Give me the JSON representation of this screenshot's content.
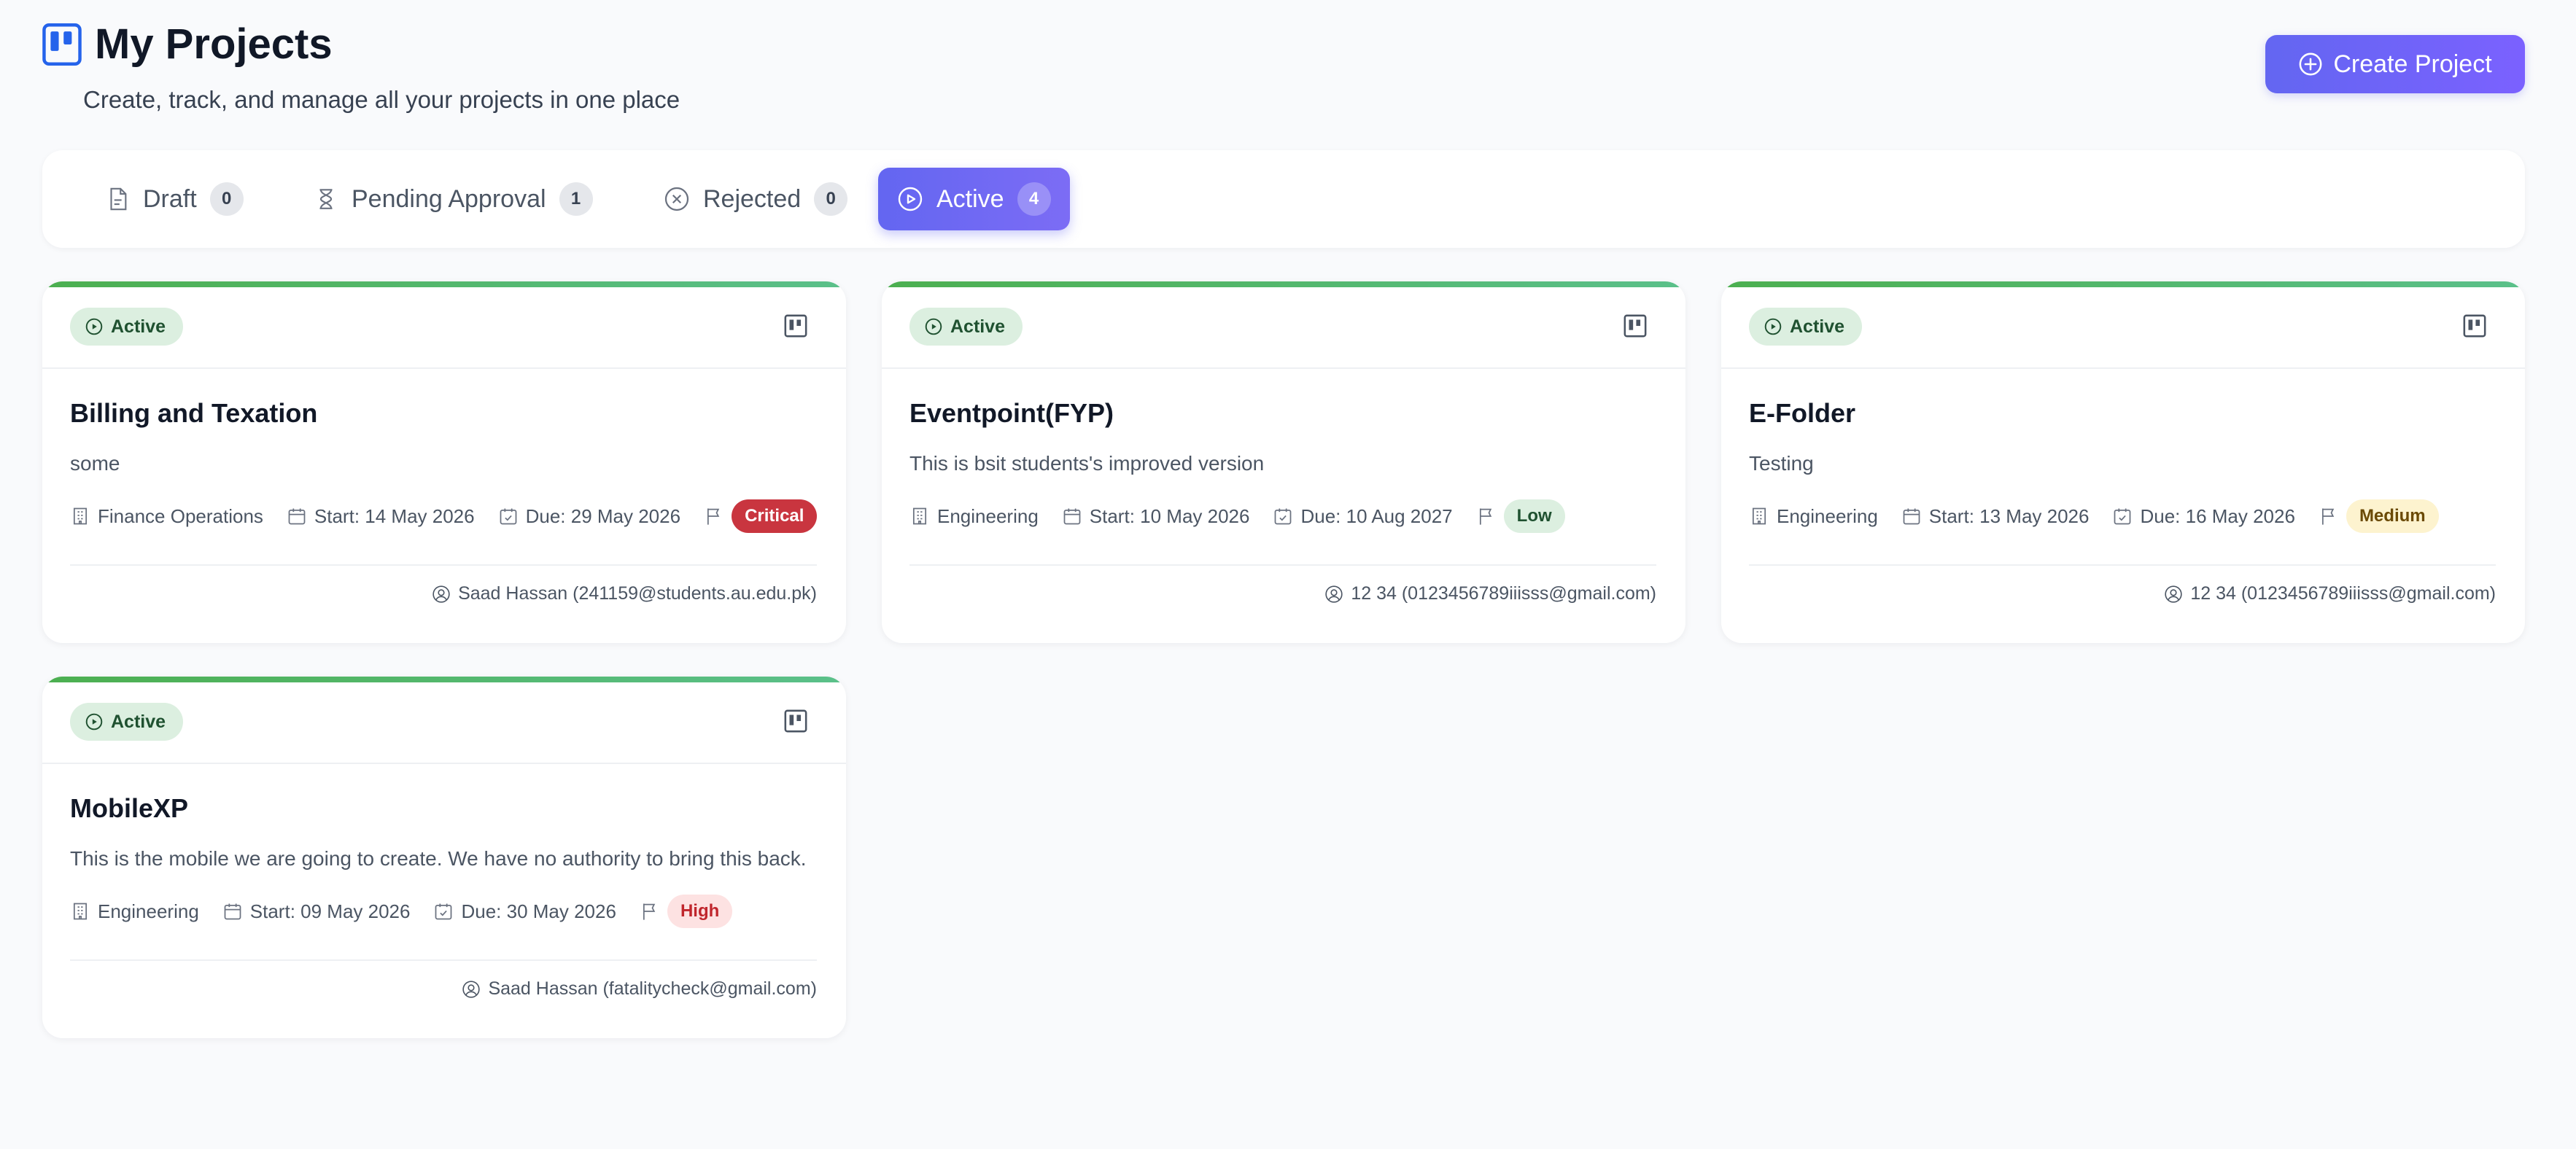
{
  "header": {
    "title": "My Projects",
    "subtitle": "Create, track, and manage all your projects in one place",
    "create_label": "Create Project"
  },
  "tabs": [
    {
      "label": "Draft",
      "count": "0",
      "icon": "document-icon"
    },
    {
      "label": "Pending Approval",
      "count": "1",
      "icon": "hourglass-icon"
    },
    {
      "label": "Rejected",
      "count": "0",
      "icon": "x-circle-icon"
    },
    {
      "label": "Active",
      "count": "4",
      "icon": "play-circle-icon",
      "selected": true
    }
  ],
  "cards": [
    {
      "status": "Active",
      "title": "Billing and Texation",
      "description": "some",
      "department": "Finance Operations",
      "start": "Start: 14 May 2026",
      "due": "Due: 29 May 2026",
      "priority": "Critical",
      "owner": "Saad Hassan (241159@students.au.edu.pk)"
    },
    {
      "status": "Active",
      "title": "Eventpoint(FYP)",
      "description": "This is bsit students's improved version",
      "department": "Engineering",
      "start": "Start: 10 May 2026",
      "due": "Due: 10 Aug 2027",
      "priority": "Low",
      "owner": "12 34 (0123456789iiisss@gmail.com)"
    },
    {
      "status": "Active",
      "title": "E-Folder",
      "description": "Testing",
      "department": "Engineering",
      "start": "Start: 13 May 2026",
      "due": "Due: 16 May 2026",
      "priority": "Medium",
      "owner": "12 34 (0123456789iiisss@gmail.com)"
    },
    {
      "status": "Active",
      "title": "MobileXP",
      "description": "This is the mobile we are going to create. We have no authority to bring this back.",
      "department": "Engineering",
      "start": "Start: 09 May 2026",
      "due": "Due: 30 May 2026",
      "priority": "High",
      "owner": "Saad Hassan (fatalitycheck@gmail.com)"
    }
  ],
  "colors": {
    "accent": "#6366f1",
    "active_bar": "#4caf50",
    "critical": "#c9353f",
    "low": "#dcefe0",
    "medium": "#fdf3cf",
    "high": "#fde2e2"
  }
}
